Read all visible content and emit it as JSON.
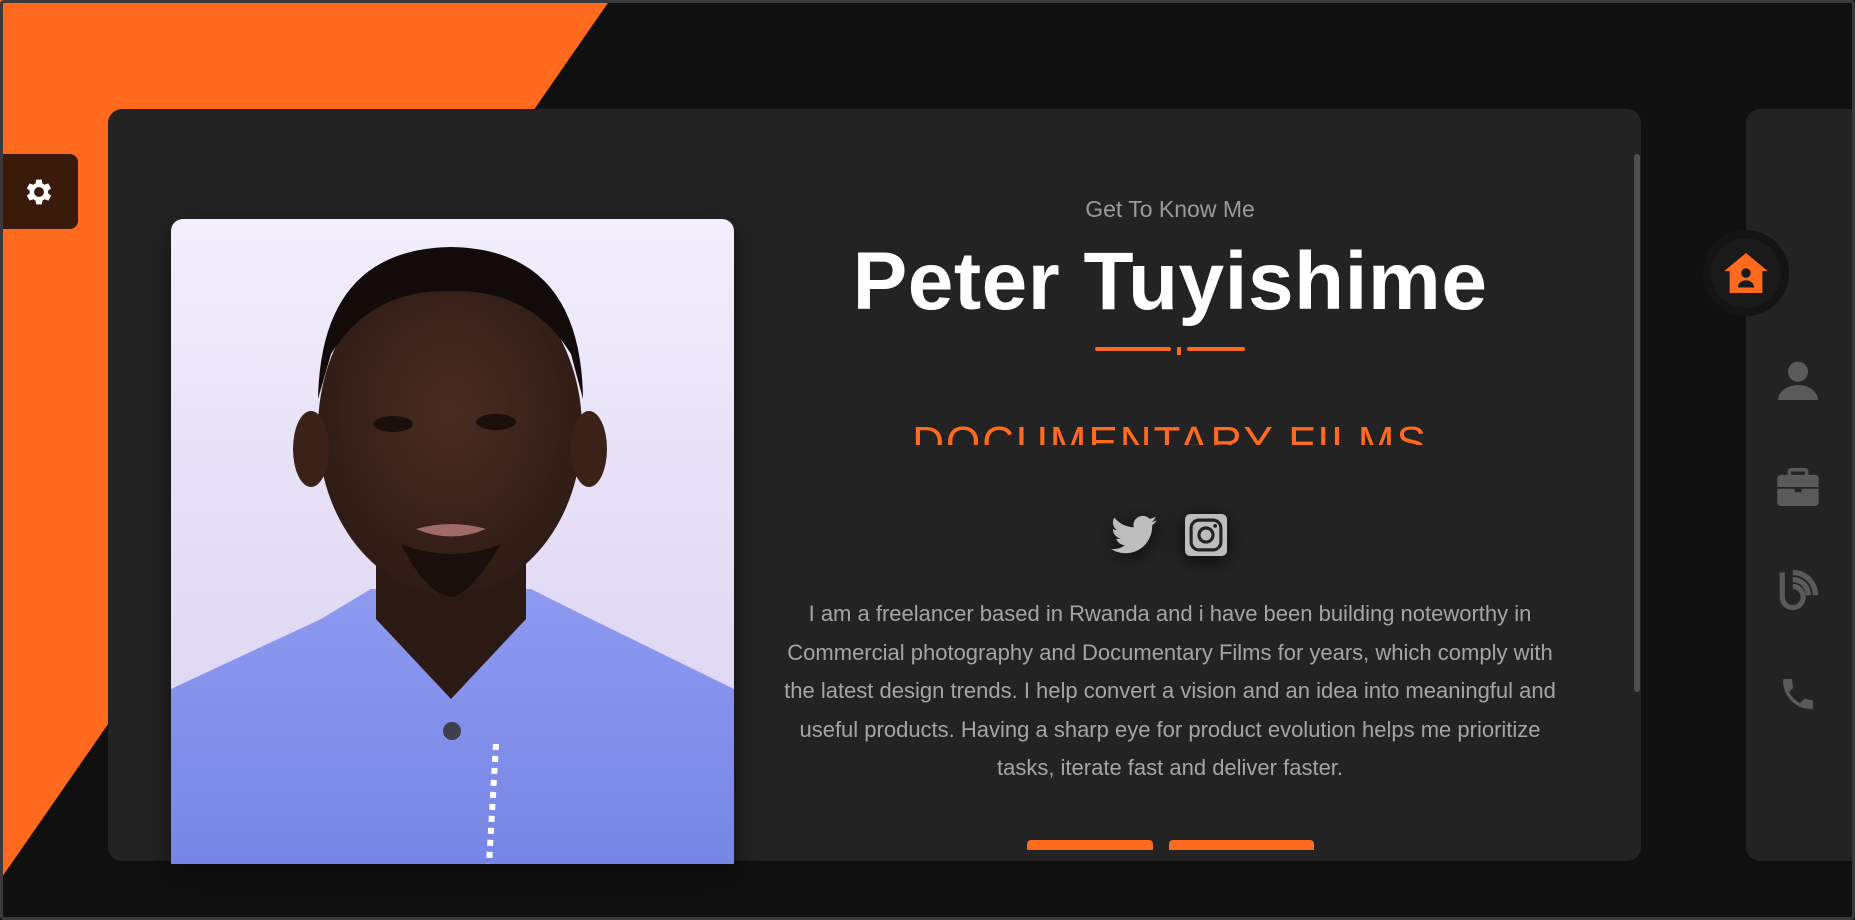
{
  "hero": {
    "eyebrow": "Get To Know Me",
    "name": "Peter Tuyishime",
    "role": "DOCUMENTARY FILMS",
    "bio": "I am a freelancer based in Rwanda and i have been building noteworthy in Commercial photography and Documentary Films for years, which comply with the latest design trends. I help convert a vision and an idea into meaningful and useful products. Having a sharp eye for product evolution helps me prioritize tasks, iterate fast and deliver faster."
  },
  "social": [
    {
      "icon": "twitter-icon"
    },
    {
      "icon": "instagram-icon"
    }
  ],
  "settings": {
    "icon": "gear-icon"
  },
  "nav": {
    "active": "home",
    "items": [
      {
        "icon": "home-icon"
      },
      {
        "icon": "user-icon"
      },
      {
        "icon": "briefcase-icon"
      },
      {
        "icon": "blog-icon"
      },
      {
        "icon": "phone-icon"
      }
    ]
  },
  "colors": {
    "accent": "#ff6a1f",
    "card": "#232323",
    "background": "#141414",
    "nav_icon": "#5a5a5a"
  }
}
